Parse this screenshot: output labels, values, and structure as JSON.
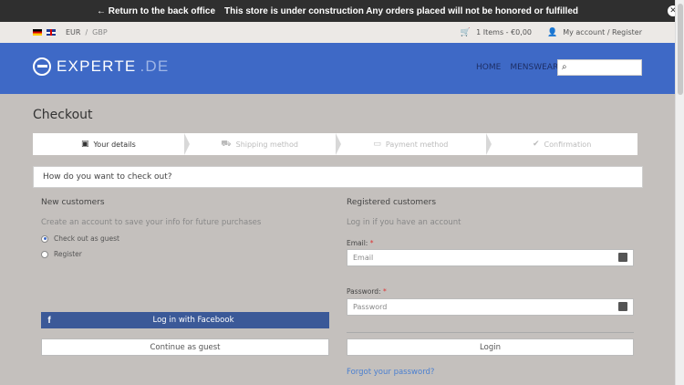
{
  "admin_bar": {
    "back_text": "← Return to the back office",
    "notice": "This store is under construction Any orders placed will not be honored or fulfilled",
    "close_glyph": "✕"
  },
  "topbar": {
    "currency_active": "EUR",
    "currency_sep": "/",
    "currency_other": "GBP",
    "cart": "1 Items - €0,00",
    "account": "My account / Register"
  },
  "header": {
    "logo_main": "EXPERTE",
    "logo_tld": ".DE",
    "nav": [
      "HOME",
      "MENSWEAR"
    ],
    "search_placeholder": ""
  },
  "page": {
    "title": "Checkout"
  },
  "steps": [
    {
      "label": "Your details",
      "icon": "id-card-icon",
      "active": true
    },
    {
      "label": "Shipping method",
      "icon": "truck-icon",
      "active": false
    },
    {
      "label": "Payment method",
      "icon": "credit-card-icon",
      "active": false
    },
    {
      "label": "Confirmation",
      "icon": "check-icon",
      "active": false
    }
  ],
  "checkout": {
    "question": "How do you want to check out?",
    "new": {
      "title": "New customers",
      "subtitle": "Create an account to save your info for future purchases",
      "option_guest": "Check out as guest",
      "option_register": "Register",
      "facebook": "Log in with Facebook",
      "continue": "Continue as guest"
    },
    "registered": {
      "title": "Registered customers",
      "subtitle": "Log in if you have an account",
      "email_label": "Email:",
      "email_placeholder": "Email",
      "password_label": "Password:",
      "password_placeholder": "Password",
      "required": "*",
      "login": "Login",
      "forgot": "Forgot your password?"
    }
  },
  "colors": {
    "brand_blue": "#3e69c6",
    "facebook": "#3b5998",
    "link": "#4a7fd0"
  }
}
